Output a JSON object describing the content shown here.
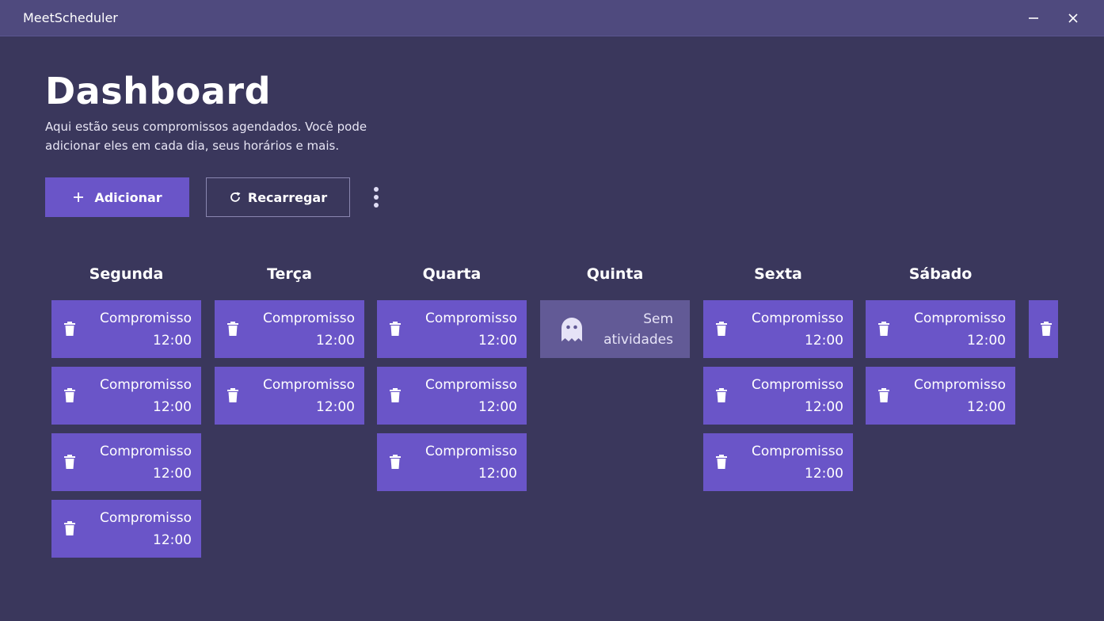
{
  "window": {
    "title": "MeetScheduler",
    "controls": [
      "minimize-icon",
      "close-icon"
    ]
  },
  "header": {
    "title": "Dashboard",
    "description": "Aqui estão seus compromissos agendados. Você pode adicionar eles em cada dia, seus horários e mais."
  },
  "toolbar": {
    "add_label": "Adicionar",
    "add_icon": "plus-icon",
    "reload_label": "Recarregar",
    "reload_icon": "refresh-icon",
    "more_icon": "more-vertical-icon"
  },
  "colors": {
    "background": "#3a375c",
    "titlebar": "#4f4a7e",
    "accent": "#6a55c8",
    "empty_card": "#625a96"
  },
  "days": [
    {
      "name": "Segunda",
      "appointments": [
        {
          "title": "Compromisso",
          "time": "12:00"
        },
        {
          "title": "Compromisso",
          "time": "12:00"
        },
        {
          "title": "Compromisso",
          "time": "12:00"
        },
        {
          "title": "Compromisso",
          "time": "12:00"
        }
      ]
    },
    {
      "name": "Terça",
      "appointments": [
        {
          "title": "Compromisso",
          "time": "12:00"
        },
        {
          "title": "Compromisso",
          "time": "12:00"
        }
      ]
    },
    {
      "name": "Quarta",
      "appointments": [
        {
          "title": "Compromisso",
          "time": "12:00"
        },
        {
          "title": "Compromisso",
          "time": "12:00"
        },
        {
          "title": "Compromisso",
          "time": "12:00"
        }
      ]
    },
    {
      "name": "Quinta",
      "appointments": [],
      "empty_text": "Sem atividades",
      "empty_icon": "ghost-icon"
    },
    {
      "name": "Sexta",
      "appointments": [
        {
          "title": "Compromisso",
          "time": "12:00"
        },
        {
          "title": "Compromisso",
          "time": "12:00"
        },
        {
          "title": "Compromisso",
          "time": "12:00"
        }
      ]
    },
    {
      "name": "Sábado",
      "appointments": [
        {
          "title": "Compromisso",
          "time": "12:00"
        },
        {
          "title": "Compromisso",
          "time": "12:00"
        }
      ]
    }
  ]
}
